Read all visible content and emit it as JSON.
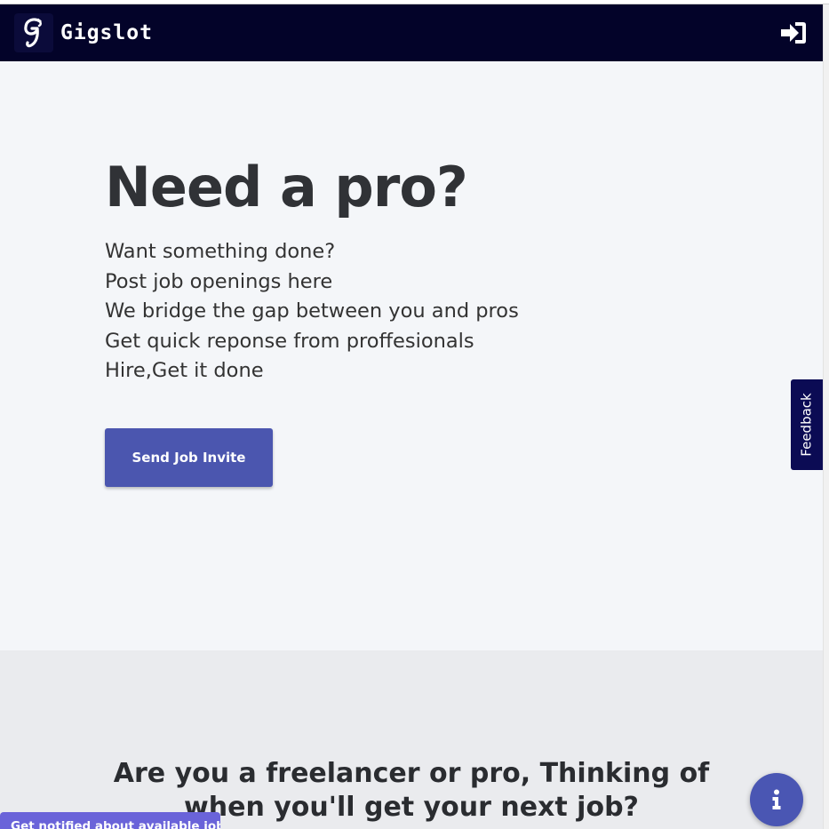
{
  "navbar": {
    "brand_name": "Gigslot",
    "logo_icon": "g-logo-icon",
    "login_icon": "sign-in-icon"
  },
  "hero": {
    "title": "Need a pro?",
    "lines": [
      "Want something done?",
      "Post job openings here",
      "We bridge the gap between you and pros",
      "Get quick reponse from proffesionals",
      "Hire,Get it done"
    ],
    "cta_label": "Send Job Invite"
  },
  "feedback_tab": {
    "label": "Feedback"
  },
  "section2": {
    "title": "Are you a freelancer or pro, Thinking of when you'll get your next job?"
  },
  "notify_bar": {
    "label": "Get notified about available jobs"
  },
  "info_button": {
    "icon": "info-icon"
  },
  "colors": {
    "navbar_bg": "#030329",
    "logo_bg": "#0b0b3a",
    "hero_bg": "#f4f6f9",
    "section2_bg": "#eaebee",
    "cta_bg": "#4b56af",
    "feedback_bg": "#0b0b54",
    "notify_bg": "#6a63d9",
    "fab_bg": "#4a56b3"
  }
}
